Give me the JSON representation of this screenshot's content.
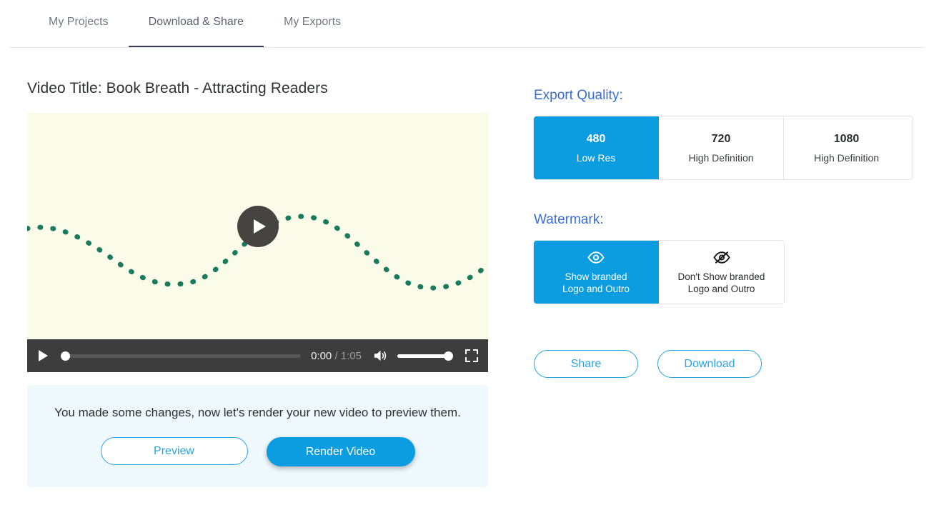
{
  "tabs": [
    {
      "label": "My Projects",
      "active": false
    },
    {
      "label": "Download & Share",
      "active": true
    },
    {
      "label": "My Exports",
      "active": false
    }
  ],
  "video": {
    "title": "Video Title: Book Breath - Attracting Readers",
    "play_overlay_icon": "play-icon",
    "controls": {
      "play_icon": "play-icon",
      "current_time": "0:00",
      "separator": "/",
      "duration": "1:05",
      "volume_icon": "volume-high-icon",
      "fullscreen_icon": "fullscreen-icon",
      "progress_percent": 0,
      "volume_percent": 100
    },
    "thumbnail": {
      "background_color": "#fafbe8",
      "wave_color": "#1a7a5e"
    }
  },
  "render_banner": {
    "message": "You made some changes, now let's render your new video to preview them.",
    "preview_label": "Preview",
    "render_label": "Render Video",
    "background_color": "#eef8fd"
  },
  "export_quality": {
    "label": "Export Quality:",
    "options": [
      {
        "resolution": "480",
        "description": "Low Res",
        "selected": true
      },
      {
        "resolution": "720",
        "description": "High Definition",
        "selected": false
      },
      {
        "resolution": "1080",
        "description": "High Definition",
        "selected": false
      }
    ]
  },
  "watermark": {
    "label": "Watermark:",
    "options": [
      {
        "icon": "eye-icon",
        "line1": "Show branded",
        "line2": "Logo and Outro",
        "selected": true
      },
      {
        "icon": "eye-off-icon",
        "line1": "Don't Show branded",
        "line2": "Logo and Outro",
        "selected": false
      }
    ]
  },
  "actions": {
    "share_label": "Share",
    "download_label": "Download"
  },
  "colors": {
    "accent_blue": "#0b9de0",
    "heading_blue": "#3b6fd4",
    "active_tab_underline": "#3b3f54"
  }
}
